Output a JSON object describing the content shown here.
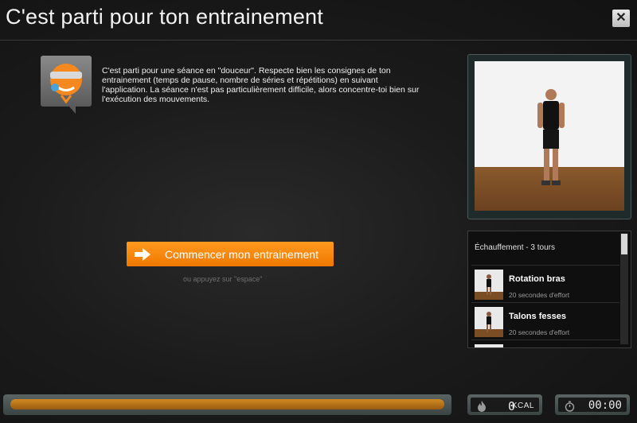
{
  "title": "C'est parti pour ton entrainement",
  "close_label": "✕",
  "coach": {
    "message": "C'est parti pour une séance en \"douceur\". Respecte bien les consignes de ton entrainement (temps de pause, nombre de séries et répétitions) en suivant l'application. La séance n'est pas particulièrement difficile, alors concentre-toi bien sur l'exécution des mouvements."
  },
  "start": {
    "label": "Commencer mon entrainement",
    "hint": "ou appuyez sur \"espace\""
  },
  "exercise_list": {
    "header": "Échauffement - 3 tours",
    "items": [
      {
        "name": "Rotation bras",
        "detail": "20 secondes d'effort"
      },
      {
        "name": "Talons fesses",
        "detail": "20 secondes d'effort"
      }
    ]
  },
  "stats": {
    "kcal_value": "0",
    "kcal_unit": "KCAL",
    "timer": "00:00",
    "progress_fraction": 1.0
  },
  "colors": {
    "accent": "#f58a0b",
    "progress": "#b8701a"
  }
}
